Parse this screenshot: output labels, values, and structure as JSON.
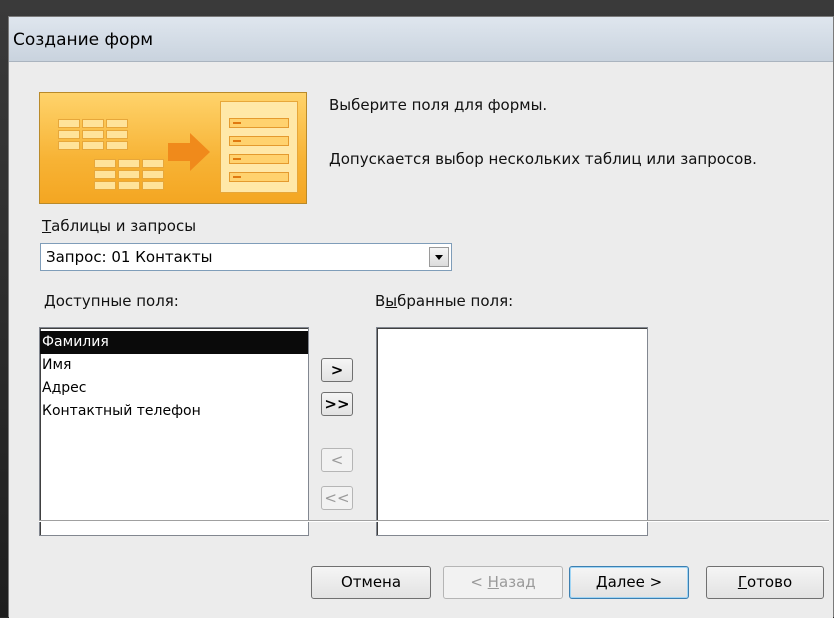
{
  "window": {
    "title": "Создание форм"
  },
  "instructions": {
    "line1": "Выберите поля для формы.",
    "line2": "Допускается выбор нескольких таблиц или запросов."
  },
  "tables_queries": {
    "label_underline": "Т",
    "label_rest": "аблицы и запросы",
    "selected": "Запрос: 01 Контакты"
  },
  "available_fields": {
    "label_underline": "Д",
    "label_rest": "оступные поля:",
    "items": [
      "Фамилия",
      "Имя",
      "Адрес",
      "Контактный телефон"
    ],
    "selected_index": 0
  },
  "selected_fields": {
    "label_pre": "В",
    "label_underline": "ы",
    "label_rest": "бранные поля:",
    "items": []
  },
  "move_buttons": {
    "add_one": ">",
    "add_all": ">>",
    "remove_one": "<",
    "remove_all": "<<"
  },
  "footer": {
    "cancel": "Отмена",
    "back_pre": "< ",
    "back_underline": "Н",
    "back_rest": "азад",
    "next_underline": "Д",
    "next_rest": "алее >",
    "finish_underline": "Г",
    "finish_rest": "отово"
  },
  "colors": {
    "accent_orange": "#f4a622",
    "selection": "#0a0a0a"
  }
}
